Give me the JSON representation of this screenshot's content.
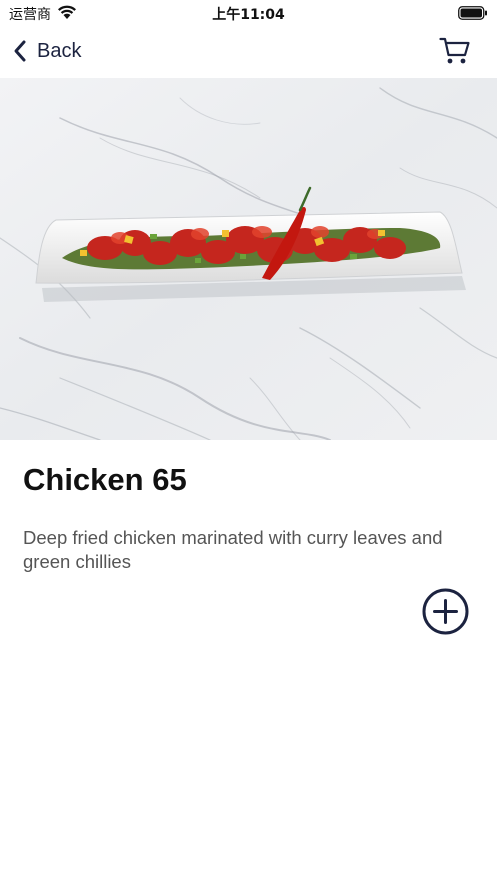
{
  "status_bar": {
    "carrier": "运营商",
    "time": "上午11:04"
  },
  "nav": {
    "back_label": "Back"
  },
  "dish": {
    "title": "Chicken 65",
    "description": "Deep fried chicken marinated with curry leaves and green chillies"
  },
  "colors": {
    "accent": "#1c2340",
    "description_text": "#555555"
  },
  "icons": {
    "back": "chevron-left-icon",
    "cart": "cart-icon",
    "add": "plus-circle-icon"
  }
}
